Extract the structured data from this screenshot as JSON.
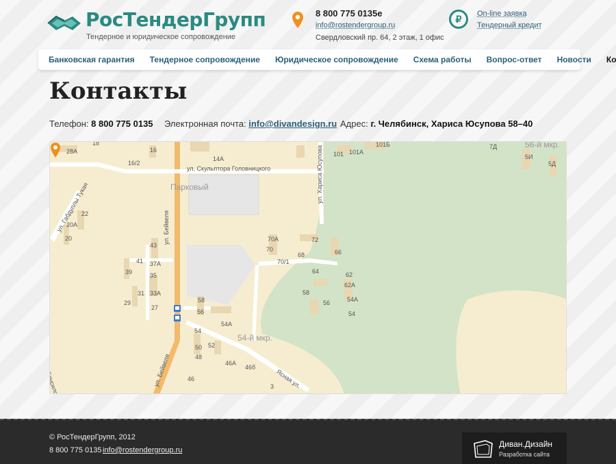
{
  "header": {
    "logo_title": "РосТендерГрупп",
    "logo_subtitle": "Тендерное и юридическое сопровождение",
    "phone": "8 800 775 0135е",
    "email": "info@rostendergroup.ru",
    "address": "Свердловский пр. 64, 2 этаж, 1 офис",
    "online_request": "On-line заявка",
    "tender_credit": "Тендерный кредит",
    "ruble_symbol": "₽"
  },
  "nav": {
    "items": [
      {
        "label": "Банковская гарантия"
      },
      {
        "label": "Тендерное сопровождение"
      },
      {
        "label": "Юридическое сопровождение"
      },
      {
        "label": "Схема работы"
      },
      {
        "label": "Вопрос-ответ"
      },
      {
        "label": "Новости"
      },
      {
        "label": "Контакты",
        "active": true
      }
    ]
  },
  "page": {
    "title": "Контакты",
    "phone_label": "Телефон:",
    "phone_value": "8 800 775 0135",
    "email_label": "Электронная почта:",
    "email_value": "info@divandesign.ru",
    "address_label": "Адрес:",
    "address_value": "г. Челябинск, Хариса Юсупова 58–40"
  },
  "map": {
    "labels": {
      "street_golovnitsky": "ул. Скульптора Головницкого",
      "district_parkovy": "Парковый",
      "street_beyvelya": "ул. Бейвеля",
      "street_beyvelya_2": "ул. Бейвеля",
      "street_tukaya": "ул. Габдуллы Тукая",
      "street_yusupova": "ул. Хариса Юсупова",
      "district_54": "54-й мкр.",
      "district_56": "56-й мкр.",
      "street_yasnaya": "Ясная ул.",
      "street_brusilova": "Брусилова",
      "house_28a": "28А",
      "house_16": "16",
      "house_162": "16/2",
      "house_14a": "14А",
      "house_22": "22",
      "house_20a": "20А",
      "house_20": "20",
      "house_43": "43",
      "house_41": "41",
      "house_37a": "37А",
      "house_39": "39",
      "house_35": "35",
      "house_31": "31",
      "house_33a": "33А",
      "house_29": "29",
      "house_27": "27",
      "house_58": "58",
      "house_56": "56",
      "house_54a": "54А",
      "house_54": "54",
      "house_52": "52",
      "house_50": "50",
      "house_48": "48",
      "house_46a": "46А",
      "house_466": "46б",
      "house_46": "46",
      "house_70a": "70А",
      "house_70": "70",
      "house_701": "70/1",
      "house_72": "72",
      "house_68": "68",
      "house_66": "66",
      "house_64": "64",
      "house_62": "62",
      "house_62a": "62А",
      "house_58b": "58",
      "house_56b": "56",
      "house_54ab": "54А",
      "house_54b": "54",
      "house_101": "101",
      "house_101a": "101А",
      "house_1015": "101Б",
      "house_7d": "7Д",
      "house_5i": "5И",
      "house_5d": "5Д",
      "house_3": "3",
      "house_18": "18"
    }
  },
  "footer": {
    "copyright": "© РосТендерГрупп, 2012",
    "phone": "8 800 775 0135",
    "email": "info@rostendergroup.ru",
    "divan_title": "Диван.Дизайн",
    "divan_sub": "Разработка сайта"
  }
}
